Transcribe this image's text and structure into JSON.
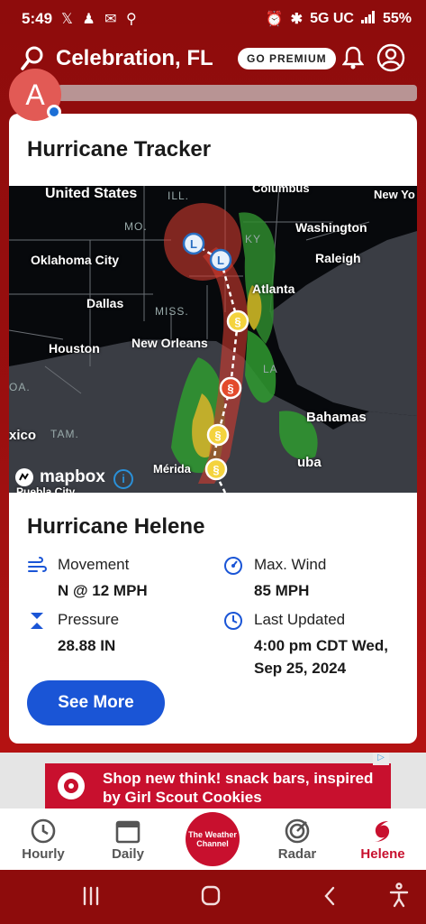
{
  "status_bar": {
    "time": "5:49",
    "network": "5G UC",
    "battery": "55%"
  },
  "header": {
    "location": "Celebration, FL",
    "premium_label": "GO PREMIUM",
    "avatar_letter": "A"
  },
  "tracker": {
    "title": "Hurricane Tracker",
    "map_labels": [
      "United States",
      "Columbus",
      "New Yo",
      "Washington",
      "Oklahoma City",
      "Raleigh",
      "Dallas",
      "Atlanta",
      "Houston",
      "New Orleans",
      "Bahamas",
      "xico",
      "uba",
      "Mérida",
      "Puebla City"
    ],
    "map_states": [
      "ILL.",
      "MO.",
      "KY",
      "MISS.",
      "OA.",
      "TAM.",
      "LA"
    ],
    "map_brand": "mapbox",
    "storm_name": "Hurricane Helene",
    "movement_label": "Movement",
    "movement_value": "N @ 12 MPH",
    "max_wind_label": "Max. Wind",
    "max_wind_value": "85 MPH",
    "pressure_label": "Pressure",
    "pressure_value": "28.88 IN",
    "updated_label": "Last Updated",
    "updated_value": "4:00 pm CDT Wed, Sep 25, 2024",
    "see_more_label": "See More"
  },
  "ad": {
    "text": "Shop new think! snack bars, inspired by Girl Scout Cookies"
  },
  "bottom_nav": {
    "hourly": "Hourly",
    "daily": "Daily",
    "center_logo": "The Weather Channel",
    "radar": "Radar",
    "helene": "Helene"
  },
  "colors": {
    "brand_red": "#c8102e",
    "header_bg": "#8e0c0c",
    "button_blue": "#1a55d6",
    "accent_blue": "#1c6fd6"
  }
}
